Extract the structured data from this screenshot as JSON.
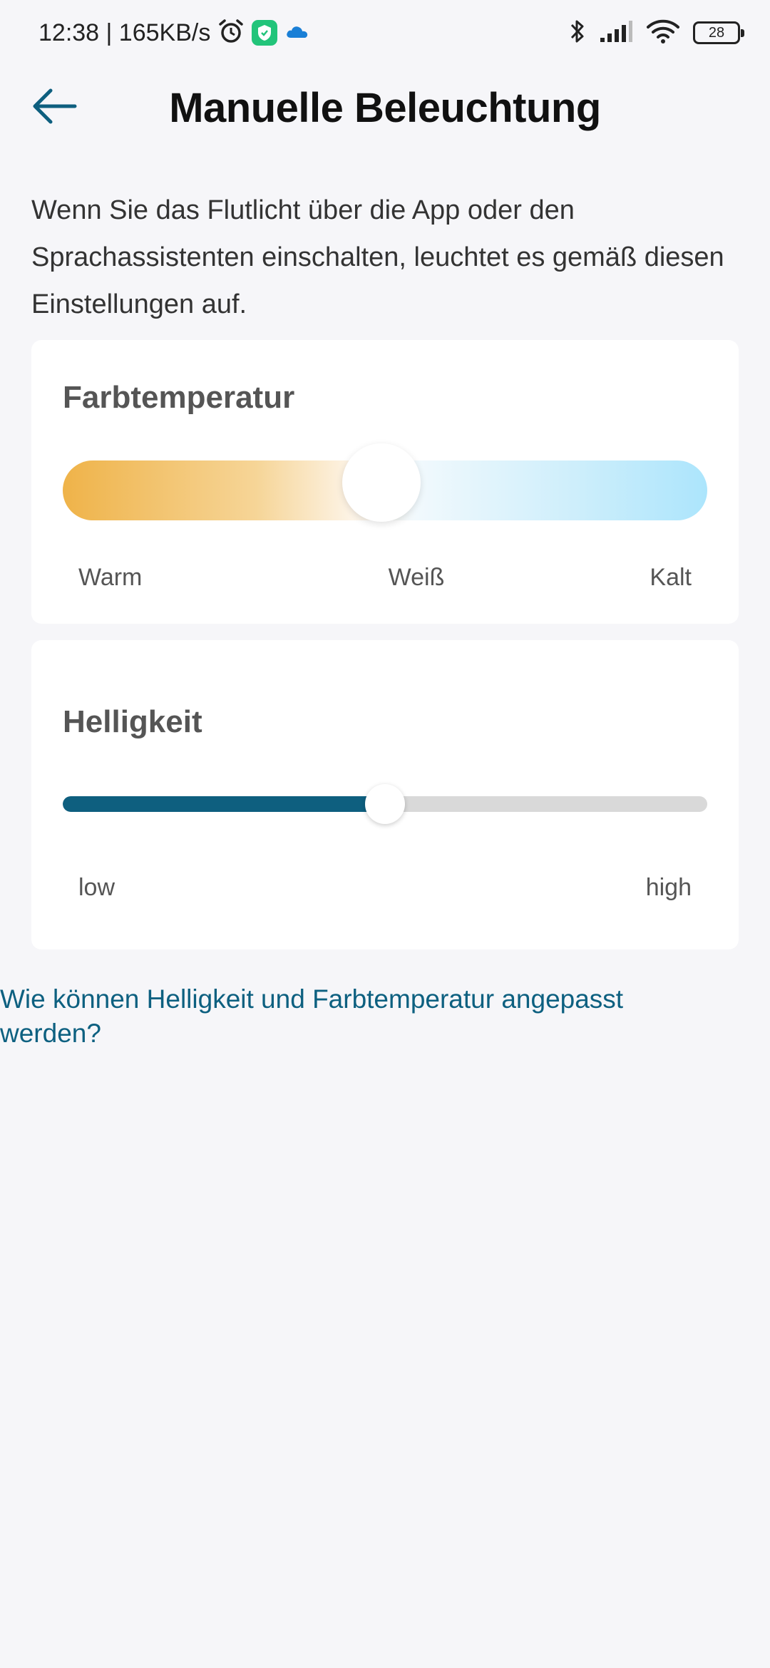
{
  "status_bar": {
    "time_speed": "12:38 | 165KB/s",
    "battery": "28",
    "icons": [
      "alarm-icon",
      "shield-app-icon",
      "cloud-icon",
      "bluetooth-icon",
      "signal-icon",
      "wifi-icon",
      "battery-icon"
    ]
  },
  "header": {
    "title": "Manuelle Beleuchtung",
    "back_icon": "arrow-left-icon"
  },
  "description": "Wenn Sie das Flutlicht über die App oder den Sprachassistenten einschalten, leuchtet es gemäß diesen Einstellungen auf.",
  "color_temperature": {
    "title": "Farbtemperatur",
    "labels": {
      "left": "Warm",
      "middle": "Weiß",
      "right": "Kalt"
    },
    "value": 0.5
  },
  "brightness": {
    "title": "Helligkeit",
    "labels": {
      "left": "low",
      "right": "high"
    },
    "value": 0.5
  },
  "help_link": "Wie können Helligkeit und Farbtemperatur angepasst werden?",
  "colors": {
    "accent": "#0e5f7f",
    "warm": "#efb349",
    "cold": "#ace5fc",
    "link": "#0d6080",
    "background": "#f6f6f9"
  }
}
